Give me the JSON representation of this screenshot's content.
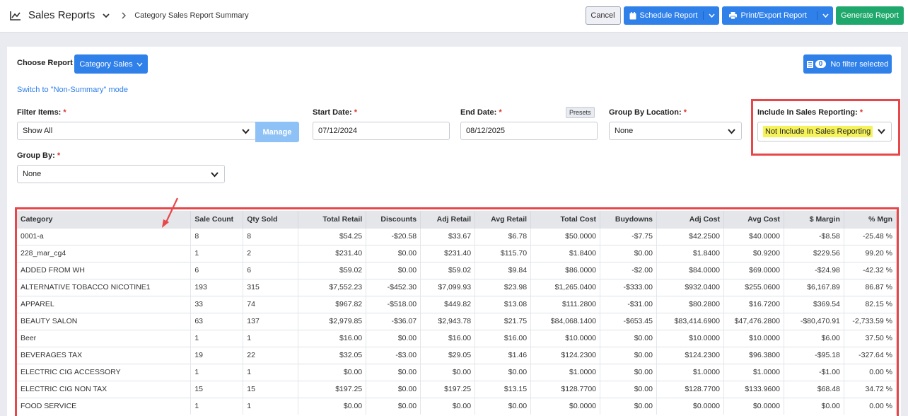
{
  "topbar": {
    "title": "Sales Reports",
    "breadcrumb": "Category Sales Report Summary",
    "cancel": "Cancel",
    "schedule": "Schedule Report",
    "print": "Print/Export Report",
    "generate": "Generate Report"
  },
  "controls": {
    "choose_report_label": "Choose Report",
    "choose_report_value": "Category Sales",
    "filter_badge": "0",
    "filter_text": "No filter selected",
    "switch_link": "Switch to \"Non-Summary\" mode",
    "filter_items_label": "Filter Items:",
    "filter_items_value": "Show All",
    "manage": "Manage",
    "start_label": "Start Date:",
    "start_value": "07/12/2024",
    "end_label": "End Date:",
    "end_value": "08/12/2025",
    "presets": "Presets",
    "group_loc_label": "Group By Location:",
    "group_loc_value": "None",
    "include_label": "Include In Sales Reporting:",
    "include_value": "Not Include In Sales Reporting",
    "group_by_label": "Group By:",
    "group_by_value": "None",
    "required_mark": "*"
  },
  "table": {
    "headers": [
      "Category",
      "Sale Count",
      "Qty Sold",
      "Total Retail",
      "Discounts",
      "Adj Retail",
      "Avg Retail",
      "Total Cost",
      "Buydowns",
      "Adj Cost",
      "Avg Cost",
      "$ Margin",
      "% Mgn"
    ],
    "rows": [
      [
        "0001-a",
        "8",
        "8",
        "$54.25",
        "-$20.58",
        "$33.67",
        "$6.78",
        "$50.0000",
        "-$7.75",
        "$42.2500",
        "$40.0000",
        "-$8.58",
        "-25.48 %"
      ],
      [
        "228_mar_cg4",
        "1",
        "2",
        "$231.40",
        "$0.00",
        "$231.40",
        "$115.70",
        "$1.8400",
        "$0.00",
        "$1.8400",
        "$0.9200",
        "$229.56",
        "99.20 %"
      ],
      [
        "ADDED FROM WH",
        "6",
        "6",
        "$59.02",
        "$0.00",
        "$59.02",
        "$9.84",
        "$86.0000",
        "-$2.00",
        "$84.0000",
        "$69.0000",
        "-$24.98",
        "-42.32 %"
      ],
      [
        "ALTERNATIVE TOBACCO NICOTINE1",
        "193",
        "315",
        "$7,552.23",
        "-$452.30",
        "$7,099.93",
        "$23.98",
        "$1,265.0400",
        "-$333.00",
        "$932.0400",
        "$255.0600",
        "$6,167.89",
        "86.87 %"
      ],
      [
        "APPAREL",
        "33",
        "74",
        "$967.82",
        "-$518.00",
        "$449.82",
        "$13.08",
        "$111.2800",
        "-$31.00",
        "$80.2800",
        "$16.7200",
        "$369.54",
        "82.15 %"
      ],
      [
        "BEAUTY SALON",
        "63",
        "137",
        "$2,979.85",
        "-$36.07",
        "$2,943.78",
        "$21.75",
        "$84,068.1400",
        "-$653.45",
        "$83,414.6900",
        "$47,476.2800",
        "-$80,470.91",
        "-2,733.59 %"
      ],
      [
        "Beer",
        "1",
        "1",
        "$16.00",
        "$0.00",
        "$16.00",
        "$16.00",
        "$10.0000",
        "$0.00",
        "$10.0000",
        "$10.0000",
        "$6.00",
        "37.50 %"
      ],
      [
        "BEVERAGES TAX",
        "19",
        "22",
        "$32.05",
        "-$3.00",
        "$29.05",
        "$1.46",
        "$124.2300",
        "$0.00",
        "$124.2300",
        "$96.3800",
        "-$95.18",
        "-327.64 %"
      ],
      [
        "ELECTRIC CIG ACCESSORY",
        "1",
        "1",
        "$0.00",
        "$0.00",
        "$0.00",
        "$0.00",
        "$1.0000",
        "$0.00",
        "$1.0000",
        "$1.0000",
        "-$1.00",
        "0.00 %"
      ],
      [
        "ELECTRIC CIG NON TAX",
        "15",
        "15",
        "$197.25",
        "$0.00",
        "$197.25",
        "$13.15",
        "$128.7700",
        "$0.00",
        "$128.7700",
        "$133.9600",
        "$68.48",
        "34.72 %"
      ],
      [
        "FOOD SERVICE",
        "1",
        "1",
        "$0.00",
        "$0.00",
        "$0.00",
        "$0.00",
        "$0.0000",
        "$0.00",
        "$0.0000",
        "$0.0000",
        "$0.00",
        "0.00 %"
      ]
    ]
  },
  "colors": {
    "accent": "#2f80e9",
    "success": "#1fa86b",
    "highlight_border": "#e8474a",
    "highlight_text": "#f5f25a"
  }
}
